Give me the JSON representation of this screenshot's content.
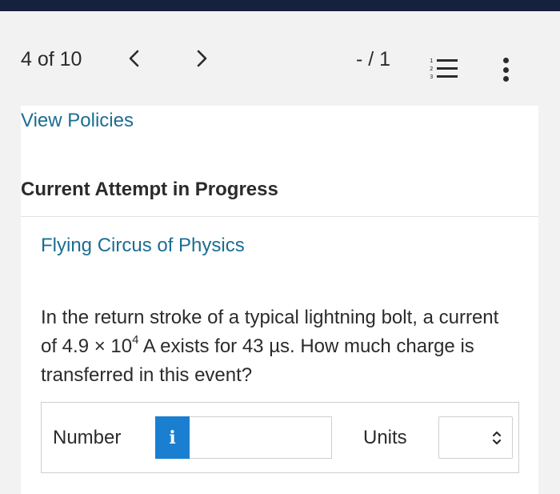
{
  "nav": {
    "counter": "4 of 10",
    "score": "- / 1"
  },
  "card": {
    "view_policies": "View Policies",
    "attempt_status": "Current Attempt in Progress",
    "question_title": "Flying Circus of Physics",
    "question": {
      "part1": "In the return stroke of a typical lightning bolt, a current of 4.9 × 10",
      "exponent": "4",
      "part2": " A exists for 43 µs. How much charge is transferred in this event?"
    },
    "answer": {
      "number_label": "Number",
      "info_label": "i",
      "number_value": "",
      "units_label": "Units",
      "units_value": ""
    }
  },
  "colors": {
    "top_strip": "#16213e",
    "link": "#1b6d94",
    "info_button": "#1a7fd0"
  },
  "icons": [
    "chevron-left-icon",
    "chevron-right-icon",
    "numbered-list-icon",
    "more-vertical-icon",
    "info-icon",
    "up-down-chevron-icon"
  ]
}
